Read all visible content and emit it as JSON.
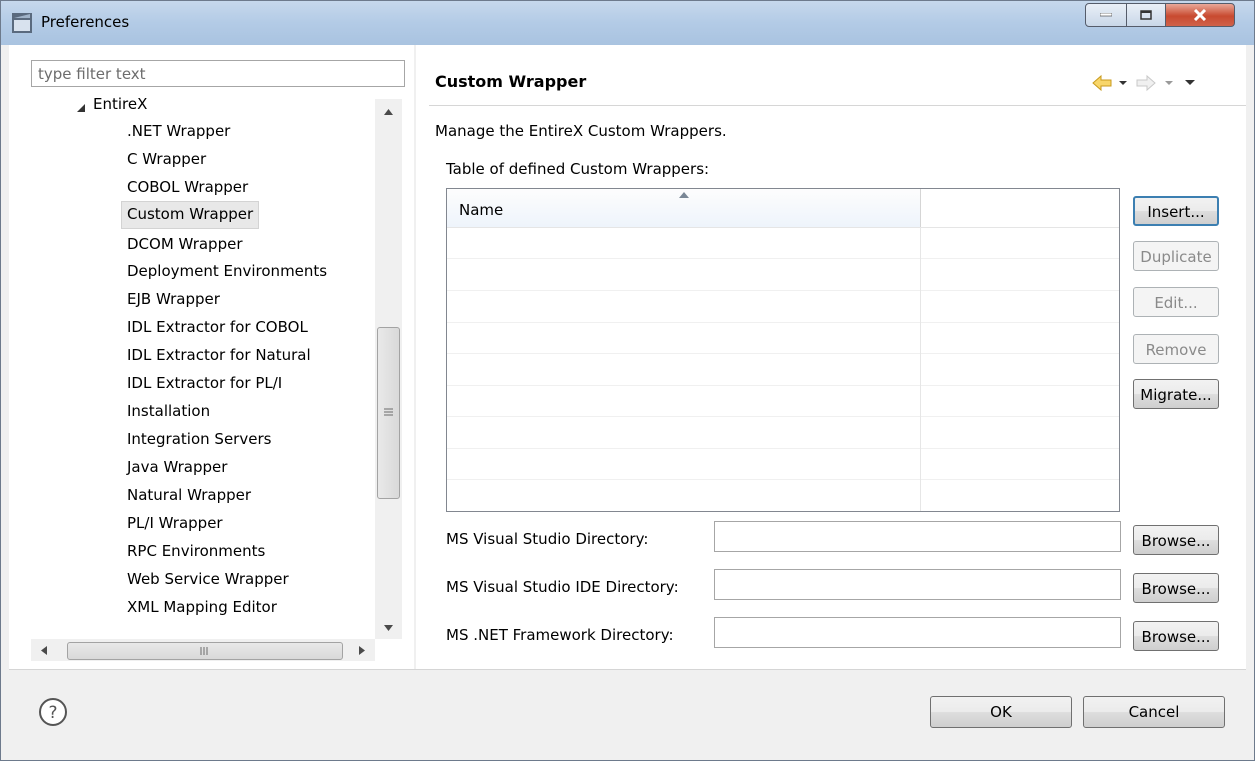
{
  "window": {
    "title": "Preferences"
  },
  "filter": {
    "placeholder": "type filter text"
  },
  "tree": {
    "parent": "EntireX",
    "items": [
      ".NET Wrapper",
      "C Wrapper",
      "COBOL Wrapper",
      "Custom Wrapper",
      "DCOM Wrapper",
      "Deployment Environments",
      "EJB Wrapper",
      "IDL Extractor for COBOL",
      "IDL Extractor for Natural",
      "IDL Extractor for PL/I",
      "Installation",
      "Integration Servers",
      "Java Wrapper",
      "Natural Wrapper",
      "PL/I Wrapper",
      "RPC Environments",
      "Web Service Wrapper",
      "XML Mapping Editor"
    ],
    "selected": "Custom Wrapper"
  },
  "page": {
    "title": "Custom Wrapper",
    "description": "Manage the EntireX Custom Wrappers.",
    "table_label": "Table of defined Custom Wrappers:",
    "table": {
      "columns": [
        "Name",
        ""
      ],
      "rows": []
    },
    "buttons": {
      "insert": "Insert...",
      "duplicate": "Duplicate",
      "edit": "Edit...",
      "remove": "Remove",
      "migrate": "Migrate..."
    },
    "fields": [
      {
        "label": "MS Visual Studio Directory:",
        "value": "",
        "browse": "Browse..."
      },
      {
        "label": "MS Visual Studio IDE Directory:",
        "value": "",
        "browse": "Browse..."
      },
      {
        "label": "MS .NET Framework Directory:",
        "value": "",
        "browse": "Browse..."
      }
    ]
  },
  "footer": {
    "ok": "OK",
    "cancel": "Cancel"
  },
  "colors": {
    "nav_back_arrow": "#e8b62c",
    "nav_forward_arrow": "#c8c8c8",
    "title_bar": "#b3cbe6"
  }
}
